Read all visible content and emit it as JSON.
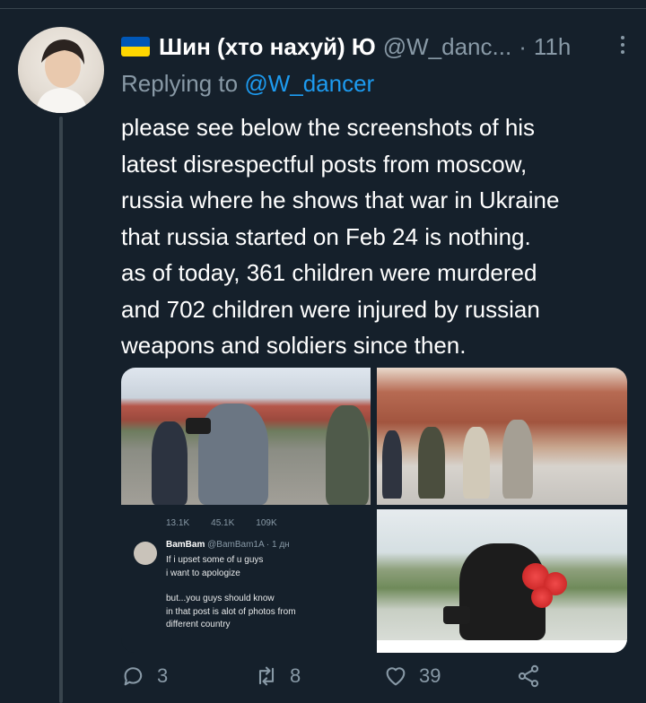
{
  "tweet": {
    "author_name": "Шин (хто нахуй) Ю",
    "author_handle": "@W_danc...",
    "separator": "·",
    "time": "11h",
    "reply_prefix": "Replying to",
    "reply_to": "@W_dancer",
    "text_lines": [
      "please see below the screenshots of his",
      "latest disrespectful posts from moscow,",
      "russia where he shows that war in Ukraine",
      "that russia started on Feb 24 is nothing.",
      "as of today, 361 children were murdered",
      "and 702 children were injured by russian",
      "weapons and soldiers since then."
    ],
    "flag_colors": [
      "#0057b7",
      "#ffd700"
    ]
  },
  "embedded_tweet": {
    "replies": "13.1K",
    "retweets": "45.1K",
    "likes": "109K",
    "author_name": "BamBam",
    "author_handle": "@BamBam1A · 1 дн",
    "lines": [
      "If i upset some of u guys",
      "i want to apologize",
      "",
      "but...you guys should know",
      "in that post is alot of photos from",
      "different country"
    ]
  },
  "actions": {
    "replies": "3",
    "retweets": "8",
    "likes": "39"
  },
  "icons": [
    "more-icon",
    "reply-icon",
    "retweet-icon",
    "like-icon",
    "share-icon",
    "ukraine-flag-icon"
  ],
  "colors": {
    "background": "#15202b",
    "muted": "#8899a6",
    "link": "#1d9bf0",
    "divider": "#38444d"
  }
}
